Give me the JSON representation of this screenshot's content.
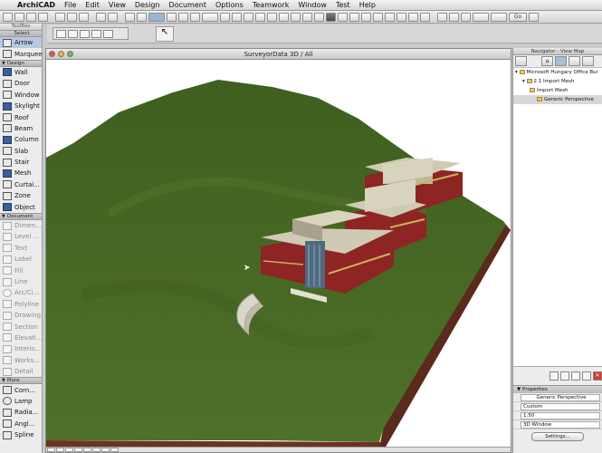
{
  "menubar": {
    "app": "ArchiCAD",
    "items": [
      "File",
      "Edit",
      "View",
      "Design",
      "Document",
      "Options",
      "Teamwork",
      "Window",
      "Test",
      "Help"
    ]
  },
  "toolbar": {
    "go_label": "Go"
  },
  "toolbox": {
    "title": "ToolBox",
    "select_header": "Select",
    "select_tools": [
      {
        "label": "Arrow",
        "icon": "arrow-icon",
        "active": true
      },
      {
        "label": "Marquee",
        "icon": "marquee-icon"
      }
    ],
    "design_header": "Design",
    "design_tools": [
      {
        "label": "Wall",
        "icon": "wall-icon"
      },
      {
        "label": "Door",
        "icon": "door-icon"
      },
      {
        "label": "Window",
        "icon": "window-icon"
      },
      {
        "label": "Skylight",
        "icon": "skylight-icon"
      },
      {
        "label": "Roof",
        "icon": "roof-icon"
      },
      {
        "label": "Beam",
        "icon": "beam-icon"
      },
      {
        "label": "Column",
        "icon": "column-icon"
      },
      {
        "label": "Slab",
        "icon": "slab-icon"
      },
      {
        "label": "Stair",
        "icon": "stair-icon"
      },
      {
        "label": "Mesh",
        "icon": "mesh-icon"
      },
      {
        "label": "Curtai...",
        "icon": "curtain-wall-icon"
      },
      {
        "label": "Zone",
        "icon": "zone-icon"
      },
      {
        "label": "Object",
        "icon": "object-icon"
      }
    ],
    "document_header": "Document",
    "document_tools": [
      {
        "label": "Dimen...",
        "icon": "dimension-icon"
      },
      {
        "label": "Level ...",
        "icon": "level-dimension-icon"
      },
      {
        "label": "Text",
        "icon": "text-icon"
      },
      {
        "label": "Label",
        "icon": "label-icon"
      },
      {
        "label": "Fill",
        "icon": "fill-icon"
      },
      {
        "label": "Line",
        "icon": "line-icon"
      },
      {
        "label": "Arc/Ci...",
        "icon": "arc-circle-icon"
      },
      {
        "label": "Polyline",
        "icon": "polyline-icon"
      },
      {
        "label": "Drawing",
        "icon": "drawing-icon"
      },
      {
        "label": "Section",
        "icon": "section-icon"
      },
      {
        "label": "Elevati...",
        "icon": "elevation-icon"
      },
      {
        "label": "Interio...",
        "icon": "interior-elevation-icon"
      },
      {
        "label": "Works...",
        "icon": "worksheet-icon"
      },
      {
        "label": "Detail",
        "icon": "detail-icon"
      }
    ],
    "more_header": "More",
    "more_tools": [
      {
        "label": "Corn...",
        "icon": "corner-window-icon"
      },
      {
        "label": "Lamp",
        "icon": "lamp-icon"
      },
      {
        "label": "Radia...",
        "icon": "radial-dimension-icon"
      },
      {
        "label": "Angl...",
        "icon": "angle-dimension-icon"
      },
      {
        "label": "Spline",
        "icon": "spline-icon"
      }
    ]
  },
  "window": {
    "title": "SurveyorData 3D / All"
  },
  "navigator": {
    "title": "Navigator - View Map",
    "tree": [
      {
        "label": "Microsoft Hungary Office Bui",
        "indent": 0,
        "selected": false
      },
      {
        "label": "2.1 Import Mesh",
        "indent": 1,
        "selected": false
      },
      {
        "label": "Import Mesh",
        "indent": 2,
        "selected": false
      },
      {
        "label": "Generic Perspective",
        "indent": 3,
        "selected": true
      }
    ],
    "properties_header": "Properties",
    "properties_name": "Generic Perspective",
    "props": [
      {
        "label": "Custom"
      },
      {
        "label": "1:50"
      },
      {
        "label": "3D Window"
      }
    ],
    "settings_label": "Settings..."
  },
  "colors": {
    "terrain": "#4a6a26",
    "building_wall": "#8e2424",
    "roof": "#cfcab4",
    "background": "#ffffff"
  }
}
